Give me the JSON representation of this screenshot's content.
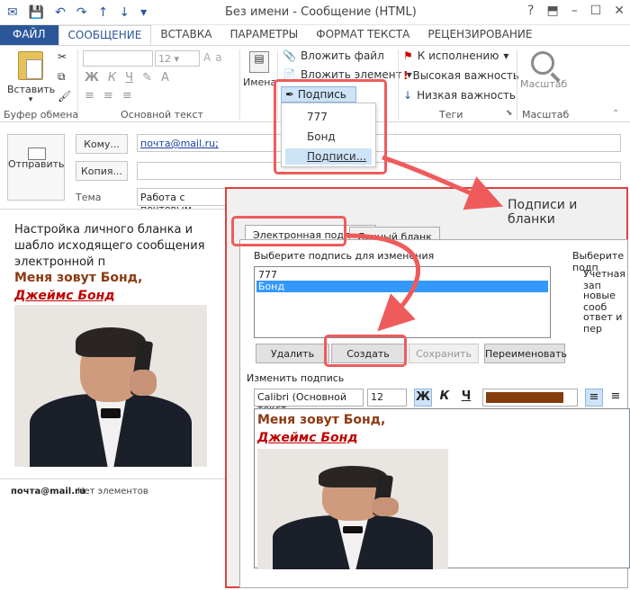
{
  "window": {
    "title": "Без имени - Сообщение (HTML)",
    "help_icon": "?"
  },
  "tabs": [
    {
      "label": "ФАЙЛ"
    },
    {
      "label": "СООБЩЕНИЕ"
    },
    {
      "label": "ВСТАВКА"
    },
    {
      "label": "ПАРАМЕТРЫ"
    },
    {
      "label": "ФОРМАТ ТЕКСТА"
    },
    {
      "label": "РЕЦЕНЗИРОВАНИЕ"
    }
  ],
  "ribbon": {
    "paste_label": "Вставить",
    "clipboard_label": "Буфер обмена",
    "font_size": "12",
    "basic_text_label": "Основной текст",
    "names_label": "Имена",
    "attach_file": "Вложить файл",
    "attach_item": "Вложить элемент",
    "signature_button": "Подпись",
    "followup": "К исполнению",
    "high_importance": "Высокая важность",
    "low_importance": "Низкая важность",
    "tags_label": "Теги",
    "zoom_label": "Масштаб",
    "zoom_group_label": "Масштаб",
    "bold_glyph": "Ж",
    "italic_glyph": "К",
    "underline_glyph": "Ч"
  },
  "signature_menu": {
    "items": [
      "777",
      "Бонд"
    ],
    "manage": "Подписи..."
  },
  "compose": {
    "send_label": "Отправить",
    "to_button": "Кому...",
    "cc_button": "Копия...",
    "subject_label": "Тема",
    "to_value": "почта@mail.ru;",
    "cc_value": "",
    "subject_value": "Работа с почтовым"
  },
  "body": {
    "text": "Настройка личного бланка и шабло исходящего сообщения электронной п",
    "sig_line1": "Меня зовут Бонд,",
    "sig_line2": "Джеймс Бонд"
  },
  "status": {
    "contact": "почта@mail.ru",
    "items": "Нет элементов"
  },
  "dialog": {
    "title": "Подписи и бланки",
    "tab_email": "Электронная подпись",
    "tab_personal": "Личный бланк",
    "choose_label": "Выберите подпись для изменения",
    "list": [
      "777",
      "Бонд"
    ],
    "right_header": "Выберите подп",
    "right_account": "Учетная зап",
    "right_new": "новые сооб",
    "right_reply": "ответ и пер",
    "btn_delete": "Удалить",
    "btn_create": "Создать",
    "btn_save": "Сохранить",
    "btn_rename": "Переименовать",
    "edit_label": "Изменить подпись",
    "font_name": "Calibri (Основной текст",
    "font_size": "12",
    "bold_glyph": "Ж",
    "italic_glyph": "К",
    "underline_glyph": "Ч",
    "sig_line1": "Меня зовут Бонд,",
    "sig_line2": "Джеймс Бонд"
  },
  "colors": {
    "accent": "#2b579a",
    "highlight": "#ef5b5b",
    "sig_brown": "#8b3a12",
    "sig_red": "#c00000",
    "font_color": "#843c0c"
  }
}
